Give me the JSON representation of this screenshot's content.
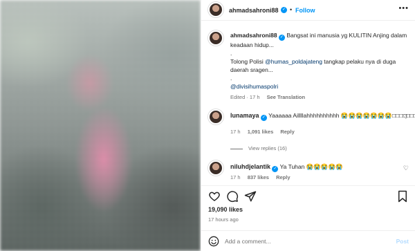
{
  "post": {
    "username": "ahmadsahroni88",
    "follow_label": "Follow",
    "more_icon": "more-icon",
    "caption": {
      "text1": "Bangsat ini manusia yg KULITIN Anjing dalam keadaan hidup...",
      "dot": ".",
      "text2_prefix": "Tolong Polisi ",
      "mention1": "@humas_poldajateng",
      "text2_suffix": " tangkap pelaku nya di duga daerah sragen...",
      "dot2": ".",
      "mention2": "@divisihumaspolri",
      "meta_edited": "Edited · 17 h",
      "meta_translate": "See Translation"
    },
    "likes": "19,090 likes",
    "time": "17 hours ago"
  },
  "comments": [
    {
      "username": "lunamaya",
      "text": "Yaaaaaa Aillllahhhhhhhhhh 😭😭😭😭😭😭😭□□□□□□□□",
      "time": "17 h",
      "likes": "1,091 likes",
      "reply": "Reply"
    },
    {
      "username": "niluhdjelantik",
      "text": "Ya Tuhan 😭😭😭😭😭",
      "time": "17 h",
      "likes": "837 likes",
      "reply": "Reply"
    }
  ],
  "view_replies": "View replies (16)",
  "add_comment": {
    "placeholder": "Add a comment...",
    "post_label": "Post"
  },
  "colors": {
    "accent": "#0095f6",
    "text": "#262626",
    "muted": "#737373",
    "post_disabled": "#b3dbff"
  }
}
